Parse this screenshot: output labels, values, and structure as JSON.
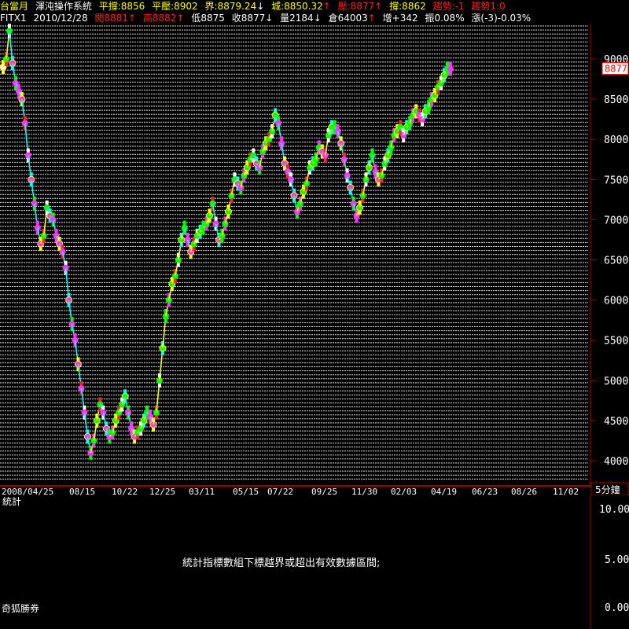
{
  "header": {
    "row1": {
      "contract": "台當月",
      "system": "渾沌操作系統",
      "ping_cheng": "平撐:8856",
      "ping_ya": "平壓:8902",
      "jie": "界:8879.24",
      "jie_arrow": "↓",
      "cheng": "城:8850.32",
      "cheng_arrow": "↑",
      "ya": "壓:8877",
      "ya_arrow": "↑",
      "zhi": "撐:8862",
      "trend1": "趨勢:-1",
      "trend2": "趨勢1:0"
    },
    "row2": {
      "symbol": "FITX1",
      "date": "2010/12/28",
      "open": "開8881",
      "open_arrow": "↑",
      "high": "高8882",
      "high_arrow": "↑",
      "low": "低8875",
      "close": "收8877",
      "close_arrow": "↓",
      "volume": "量2184",
      "volume_arrow": "↓",
      "oi": "倉64003",
      "oi_arrow": "↑",
      "oi_change": "增+342",
      "amplitude": "振0.08%",
      "change": "漲(-3)-0.03%"
    }
  },
  "colors": {
    "yellow": "#ffff00",
    "red": "#ff2020",
    "white": "#ffffff",
    "cyan": "#00ffff",
    "green": "#00ff00",
    "magenta": "#ff33ff",
    "border": "#a00000",
    "price_marker": "#ff0000"
  },
  "chart_data": {
    "type": "line",
    "y_ticks": [
      "9000",
      "8500",
      "8000",
      "7500",
      "7000",
      "6500",
      "6000",
      "5500",
      "5000",
      "4500",
      "4000"
    ],
    "ylim": [
      3850,
      9200
    ],
    "x_ticks": [
      "2008/04/25",
      "08/15",
      "10/22",
      "12/25",
      "03/11",
      "05/15",
      "07/22",
      "09/25",
      "11/30",
      "02/03",
      "04/19",
      "06/23",
      "08/26",
      "11/02"
    ],
    "x": [
      0,
      4,
      8,
      12,
      16,
      20,
      24,
      28,
      32,
      36,
      40,
      44,
      48,
      52,
      56,
      60,
      64,
      68,
      72,
      76,
      80,
      84,
      88,
      92,
      96,
      100,
      104,
      108,
      112,
      116,
      120,
      124,
      128,
      132,
      136,
      140,
      144,
      148,
      152,
      156,
      160,
      164,
      168,
      172,
      176,
      180,
      184,
      188,
      192,
      196,
      200,
      204,
      208,
      212,
      216,
      220,
      224,
      228,
      232,
      236,
      240,
      244,
      248,
      252,
      256,
      260,
      264,
      268,
      272,
      276,
      280,
      284,
      288,
      292,
      296,
      300,
      304,
      308,
      312,
      316,
      320,
      324,
      328,
      332,
      336,
      340,
      344,
      348,
      352,
      356,
      360,
      364,
      368,
      372,
      376,
      380,
      384,
      388,
      392,
      396,
      400,
      404,
      408,
      412,
      416,
      420,
      424,
      428,
      432,
      436,
      440,
      444,
      448,
      452,
      456,
      460,
      464,
      468,
      472,
      476,
      480,
      484,
      488,
      492,
      496,
      500,
      504,
      508,
      512,
      516,
      520,
      524,
      528,
      532,
      536,
      540,
      544,
      548,
      552,
      556,
      560,
      564,
      568,
      572,
      576,
      580,
      584,
      588,
      592,
      596,
      600,
      604,
      608,
      612,
      616,
      620,
      624,
      628,
      632,
      636,
      640,
      644,
      648,
      652,
      656,
      660,
      664,
      668,
      672,
      676,
      680,
      684,
      688,
      692,
      696,
      700,
      704,
      708,
      712,
      716,
      720,
      724,
      728,
      732,
      736,
      740,
      744
    ],
    "series": [
      {
        "values": [
          8900,
          9000,
          9350,
          8950,
          8700,
          8600,
          8500,
          8200,
          7800,
          7500,
          7200,
          6900,
          6700,
          6800,
          7150,
          7050,
          7000,
          6800,
          6700,
          6600,
          6400,
          6000,
          5700,
          5500,
          5200,
          4900,
          4600,
          4300,
          4100,
          4250,
          4500,
          4700,
          4600,
          4400,
          4300,
          4350,
          4500,
          4600,
          4700,
          4800,
          4600,
          4400,
          4300,
          4350,
          4400,
          4500,
          4600,
          4550,
          4450,
          4600,
          5000,
          5400,
          5800,
          6000,
          6200,
          6300,
          6500,
          6750,
          6900,
          6750,
          6600,
          6700,
          6800,
          6850,
          6900,
          6950,
          7050,
          7200,
          6950,
          6750,
          6800,
          6950,
          7100,
          7300,
          7500,
          7450,
          7400,
          7550,
          7650,
          7750,
          7800,
          7700,
          7650,
          7850,
          7950,
          8000,
          8100,
          8300,
          8200,
          7950,
          7700,
          7600,
          7500,
          7300,
          7100,
          7200,
          7350,
          7450,
          7650,
          7700,
          7750,
          7900,
          7850,
          7800,
          8050,
          8150,
          8150,
          8100,
          7950,
          7750,
          7550,
          7400,
          7200,
          7050,
          7150,
          7300,
          7500,
          7650,
          7800,
          7600,
          7500,
          7550,
          7700,
          7800,
          7900,
          8050,
          8100,
          8150,
          8050,
          8150,
          8200,
          8300,
          8350,
          8300,
          8250,
          8350,
          8400,
          8500,
          8550,
          8650,
          8700,
          8800,
          8880,
          8877
        ]
      }
    ]
  },
  "price_marker": "8877",
  "period_label": "5分鐘",
  "sub_panel": {
    "title": "統計",
    "y_ticks": [
      "10.00",
      "5.00",
      "0.00"
    ],
    "message": "統計指標數組下標越界或超出有效數據區間;",
    "footer": "奇狐勝券"
  }
}
